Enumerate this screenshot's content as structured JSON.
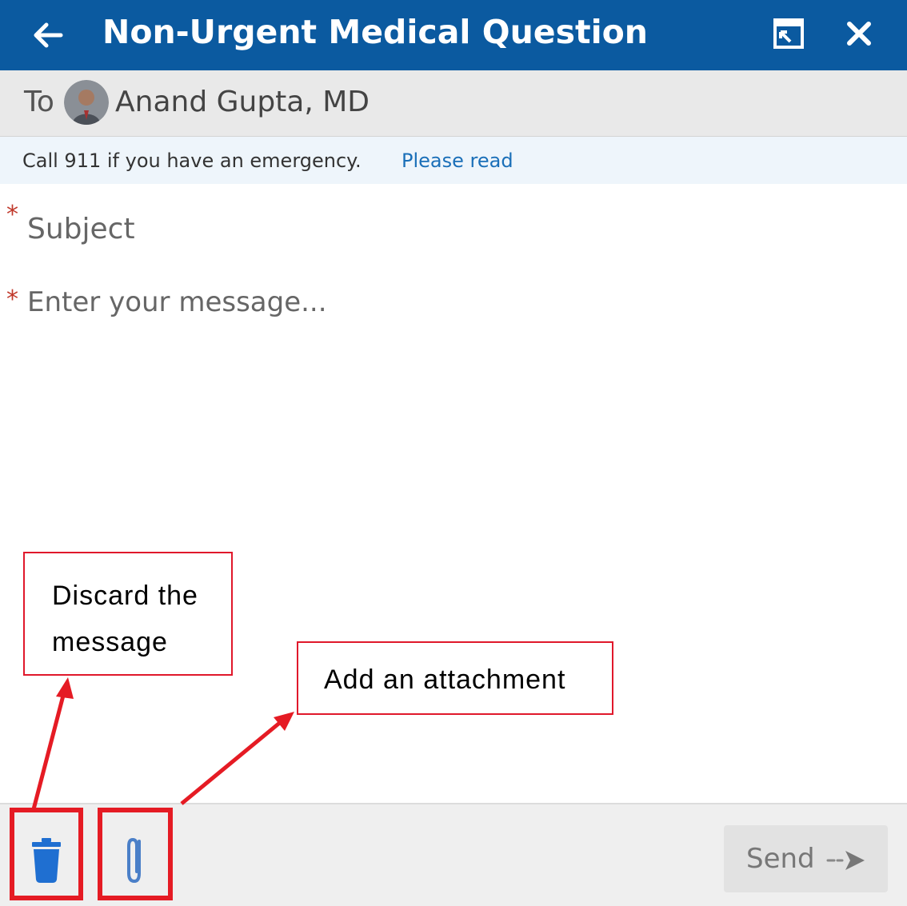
{
  "header": {
    "title": "Non-Urgent Medical Question",
    "back_icon": "arrow-left-icon",
    "popout_icon": "popout-icon",
    "close_icon": "close-icon",
    "background": "#0b5aa0"
  },
  "recipient": {
    "to_label": "To",
    "name": "Anand Gupta, MD"
  },
  "notice": {
    "text": "Call 911 if you have an emergency.",
    "link": "Please read"
  },
  "form": {
    "subject_placeholder": "Subject",
    "message_placeholder": "Enter your message...",
    "required_mark": "*"
  },
  "footer": {
    "discard_icon": "trash-icon",
    "attach_icon": "paperclip-icon",
    "send_label": "Send",
    "send_icon": "send-arrow-icon"
  },
  "annotations": {
    "discard_line1": "Discard the",
    "discard_line2": "message",
    "attach": "Add an attachment",
    "color": "#e51b24"
  }
}
